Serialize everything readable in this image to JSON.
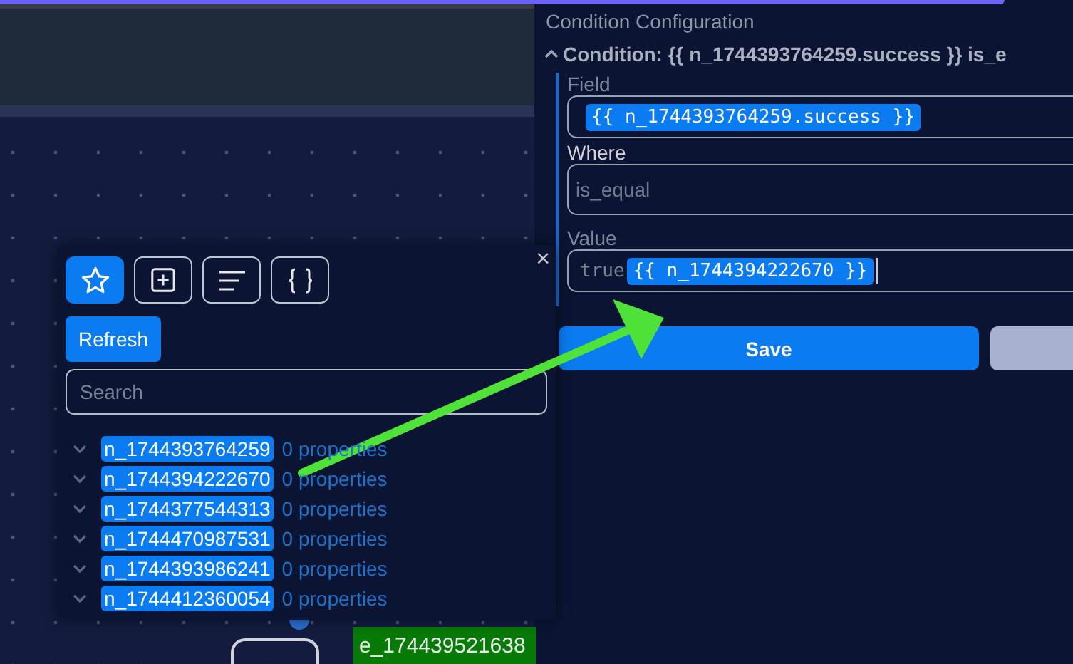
{
  "canvas": {
    "nodes": [
      {
        "kind": "outline"
      },
      {
        "kind": "label",
        "label": "e_174439521638"
      }
    ]
  },
  "variable_picker": {
    "close": "×",
    "tools": [
      {
        "kind": "star",
        "selected": true
      },
      {
        "kind": "plus",
        "selected": false
      },
      {
        "kind": "lines",
        "selected": false
      },
      {
        "kind": "braces",
        "selected": false
      }
    ],
    "refresh": "Refresh",
    "search": {
      "placeholder": "Search"
    },
    "items": [
      {
        "name": "n_1744393764259",
        "count": "0 properties",
        "expanded": false
      },
      {
        "name": "n_1744394222670",
        "count": "0 properties",
        "expanded": false
      },
      {
        "name": "n_1744377544313",
        "count": "0 properties",
        "expanded": false
      },
      {
        "name": "n_1744470987531",
        "count": "0 properties",
        "expanded": false
      },
      {
        "name": "n_1744393986241",
        "count": "0 properties",
        "expanded": false
      },
      {
        "name": "n_1744412360054",
        "count": "0 properties",
        "expanded": false
      }
    ]
  },
  "panel": {
    "title": "Condition Configuration",
    "condition": {
      "title": "Condition: {{ n_1744393764259.success }} is_e",
      "expanded": true
    },
    "fields": [
      {
        "label": "Field",
        "kind": "chips",
        "chips": [
          "{{ n_1744393764259.success }}"
        ]
      },
      {
        "label": "Where",
        "kind": "select",
        "placeholder": "is_equal"
      },
      {
        "label": "Value",
        "kind": "mixed",
        "text": "true",
        "chips": [
          "{{ n_1744394222670 }}"
        ]
      }
    ],
    "buttons": [
      {
        "label": "Save",
        "kind": "primary"
      },
      {
        "kind": "secondary"
      }
    ]
  }
}
